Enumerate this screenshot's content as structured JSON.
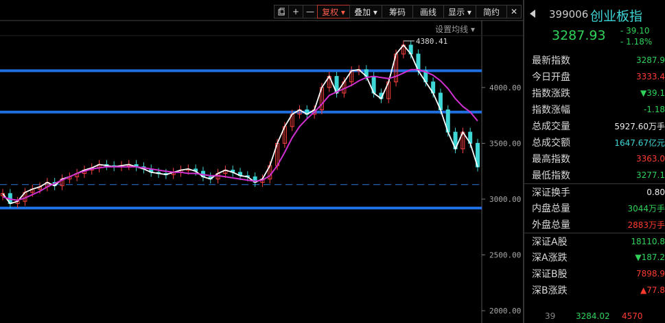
{
  "toolbar": {
    "buttons": [
      {
        "label": "复权 ▾",
        "active": true
      },
      {
        "label": "叠加 ▾",
        "active": false
      },
      {
        "label": "筹码",
        "active": false
      },
      {
        "label": "画线",
        "active": false
      },
      {
        "label": "显示 ▾",
        "active": false
      },
      {
        "label": "简约",
        "active": false
      }
    ],
    "icons": [
      "restore-icon",
      "plus-icon",
      "minus-icon"
    ],
    "ma_settings_label": "设置均线 ▾"
  },
  "chart_data": {
    "type": "candlestick",
    "y_ticks": [
      "4000.00",
      "3500.00",
      "3000.00",
      "2500.00",
      "2000.00"
    ],
    "y_tick_values": [
      4000,
      3500,
      3000,
      2500,
      2000
    ],
    "ylim": [
      1890,
      4600
    ],
    "peak_label": "4380.41",
    "horizontal_lines": [
      4150,
      3780,
      2920
    ],
    "dashed_line": 3130,
    "close_series": [
      3050,
      2960,
      2980,
      3060,
      3090,
      3110,
      3150,
      3120,
      3180,
      3200,
      3230,
      3260,
      3280,
      3310,
      3300,
      3290,
      3300,
      3310,
      3290,
      3270,
      3240,
      3230,
      3220,
      3240,
      3260,
      3270,
      3250,
      3200,
      3180,
      3230,
      3260,
      3240,
      3210,
      3200,
      3150,
      3180,
      3300,
      3500,
      3650,
      3760,
      3800,
      3760,
      3800,
      4000,
      4100,
      3950,
      4050,
      4150,
      4160,
      4100,
      3950,
      3900,
      4050,
      4300,
      4380,
      4300,
      4150,
      4050,
      3950,
      3800,
      3600,
      3450,
      3600,
      3500,
      3288
    ],
    "ma20_series": [
      3020,
      3000,
      2990,
      3010,
      3040,
      3070,
      3110,
      3140,
      3170,
      3200,
      3230,
      3250,
      3270,
      3280,
      3290,
      3290,
      3290,
      3290,
      3290,
      3280,
      3270,
      3260,
      3250,
      3240,
      3240,
      3230,
      3230,
      3220,
      3210,
      3210,
      3200,
      3190,
      3180,
      3170,
      3160,
      3170,
      3210,
      3300,
      3420,
      3550,
      3650,
      3720,
      3780,
      3850,
      3930,
      3960,
      3990,
      4020,
      4060,
      4090,
      4100,
      4090,
      4080,
      4100,
      4130,
      4160,
      4160,
      4140,
      4110,
      4060,
      3990,
      3900,
      3830,
      3780,
      3700
    ]
  },
  "quote": {
    "code": "399006",
    "name": "创业板指",
    "price": "3287.93",
    "change": "- 39.10",
    "change_pct": "- 1.18%",
    "rows": [
      {
        "label": "最新指数",
        "value": "3287.9",
        "color": "dn"
      },
      {
        "label": "今日开盘",
        "value": "3333.4",
        "color": "up"
      },
      {
        "label": "指数涨跌",
        "value": "▼39.1",
        "color": "dn"
      },
      {
        "label": "指数涨幅",
        "value": "-1.18",
        "color": "dn"
      },
      {
        "label": "总成交量",
        "value": "5927.60万手",
        "color": "wh"
      },
      {
        "label": "总成交额",
        "value": "1647.67亿元",
        "color": "cy"
      },
      {
        "label": "最高指数",
        "value": "3363.0",
        "color": "up"
      },
      {
        "label": "最低指数",
        "value": "3277.1",
        "color": "dn"
      },
      {
        "label": "深证换手",
        "value": "0.80",
        "color": "wh"
      },
      {
        "label": "内盘总量",
        "value": "3044万手",
        "color": "dn"
      },
      {
        "label": "外盘总量",
        "value": "2883万手",
        "color": "up"
      },
      {
        "label": "深证A股",
        "value": "18110.8",
        "color": "dn"
      },
      {
        "label": "深A涨跌",
        "value": "▼187.2",
        "color": "dn"
      },
      {
        "label": "深证B股",
        "value": "7898.9",
        "color": "up"
      },
      {
        "label": "深B涨跌",
        "value": "▲77.8",
        "color": "up"
      }
    ],
    "bottom": {
      "left": "39",
      "mid": "3284.02",
      "right": "4570"
    }
  }
}
